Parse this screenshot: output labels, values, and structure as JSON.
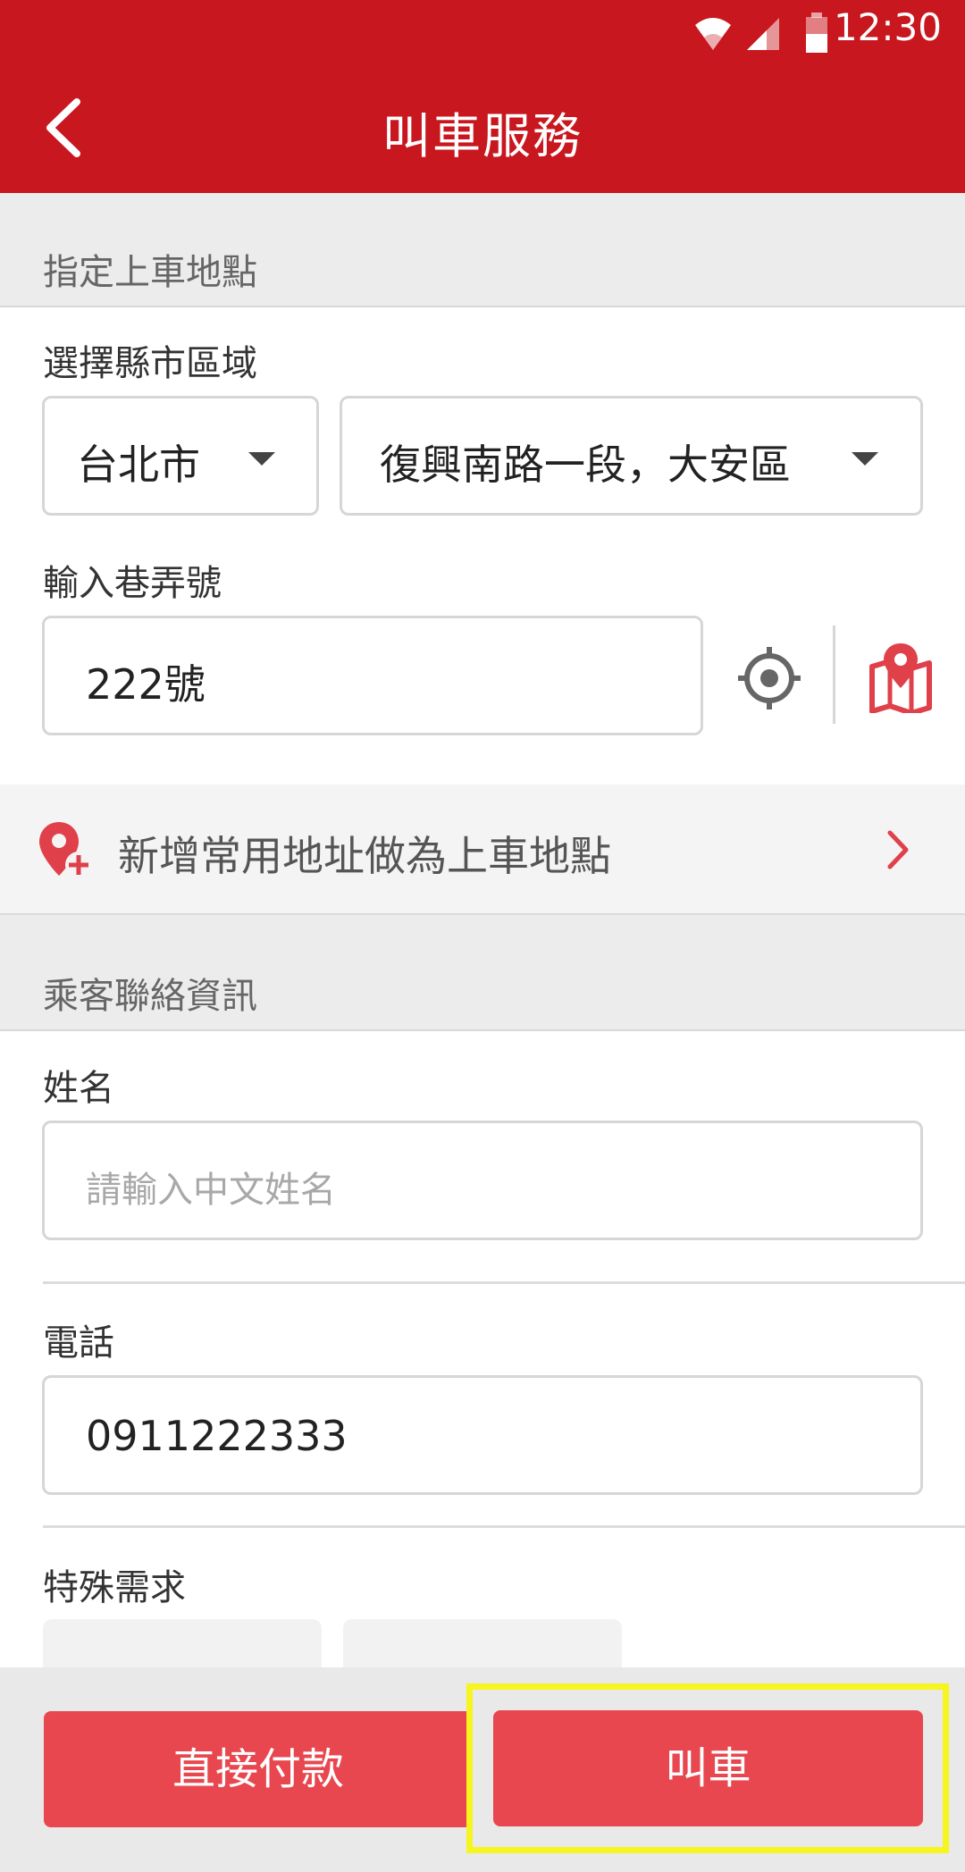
{
  "status_bar": {
    "time": "12:30"
  },
  "header": {
    "title": "叫車服務"
  },
  "pickup_section": {
    "title": "指定上車地點",
    "region_label": "選擇縣市區域",
    "city": "台北市",
    "district": "復興南路一段，大安區",
    "lane_label": "輸入巷弄號",
    "lane_value": "222號"
  },
  "favorite_address": {
    "label": "新增常用地址做為上車地點"
  },
  "contact_section": {
    "title": "乘客聯絡資訊",
    "name_label": "姓名",
    "name_placeholder": "請輸入中文姓名",
    "phone_label": "電話",
    "phone_value": "0911222333",
    "special_label": "特殊需求"
  },
  "actions": {
    "pay_label": "直接付款",
    "call_label": "叫車"
  },
  "colors": {
    "brand_red": "#c8171e",
    "button_red": "#e8474f",
    "highlight_yellow": "#f6f51f"
  },
  "icons": [
    "back-arrow-icon",
    "wifi-icon",
    "signal-icon",
    "battery-icon",
    "caret-down-icon",
    "locate-crosshair-icon",
    "map-pin-icon",
    "add-location-icon",
    "chevron-right-icon"
  ]
}
